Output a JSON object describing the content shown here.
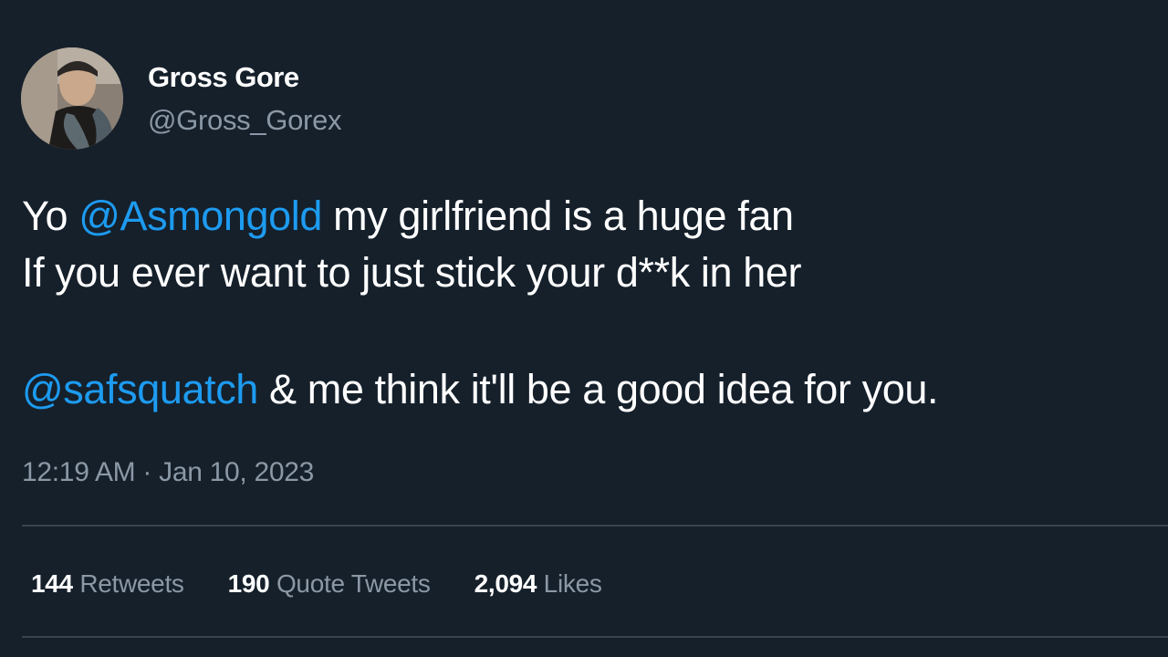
{
  "author": {
    "display_name": "Gross Gore",
    "handle": "@Gross_Gorex"
  },
  "tweet": {
    "line1": {
      "pre": "Yo ",
      "mention": "@Asmongold",
      "post": " my girlfriend is a huge fan"
    },
    "line2": "If you ever want to just stick your d**k in her",
    "line3": {
      "mention": "@safsquatch",
      "post": " & me think it'll be a good idea for you."
    },
    "timestamp": "12:19 AM · Jan 10, 2023"
  },
  "stats": {
    "retweets": {
      "count": "144",
      "label": "Retweets"
    },
    "quotes": {
      "count": "190",
      "label": "Quote Tweets"
    },
    "likes": {
      "count": "2,094",
      "label": "Likes"
    }
  },
  "colors": {
    "background": "#15202b",
    "mention": "#1d9bf0",
    "secondary_text": "#8b98a5",
    "divider": "#38444d"
  }
}
